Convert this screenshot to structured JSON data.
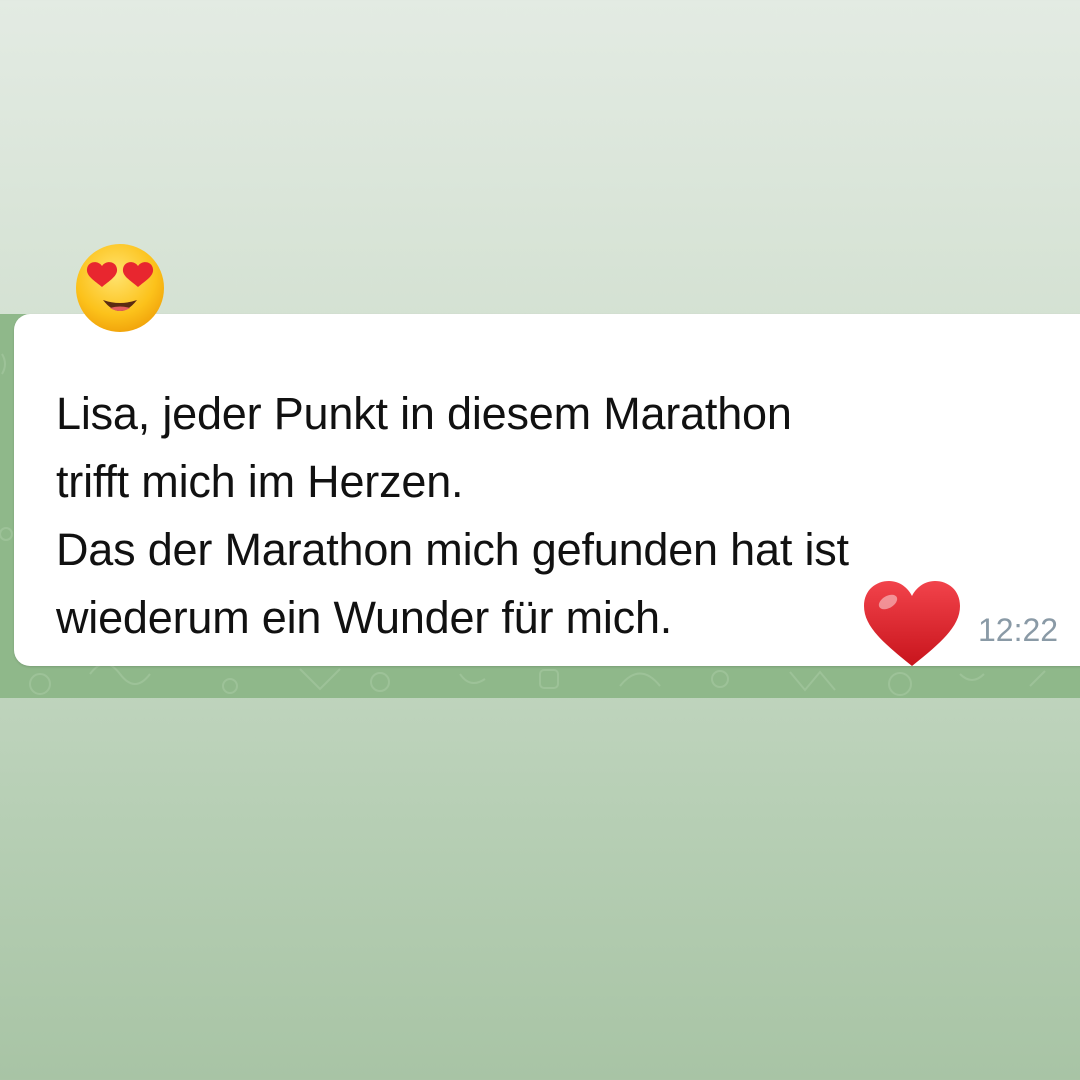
{
  "message": {
    "text": "Lisa, jeder Punkt in diesem Marathon\ntrifft mich im Herzen.\nDas der Marathon mich gefunden hat ist\nwiederum ein Wunder für mich.",
    "time": "12:22",
    "reaction_icon": "heart-eyes-emoji",
    "inline_icon": "red-heart-emoji"
  },
  "colors": {
    "bubble": "#ffffff",
    "chat_background": "#8fb88a",
    "page_gradient_top": "#e3ebe3",
    "page_gradient_bottom": "#a8c4a5",
    "timestamp": "#8a9aa6",
    "heart": "#e0242c"
  }
}
